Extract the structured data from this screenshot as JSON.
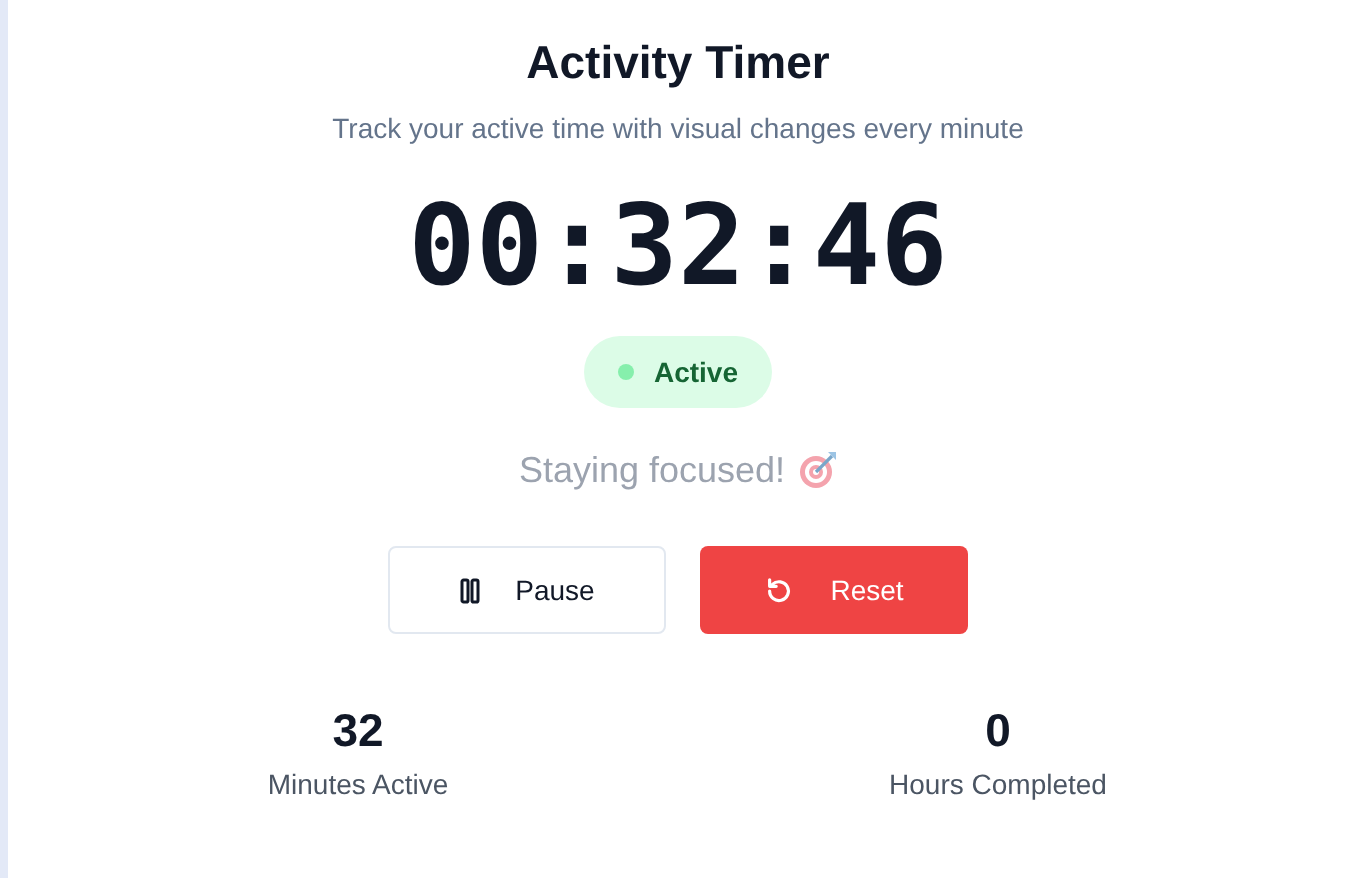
{
  "title": "Activity Timer",
  "subtitle": "Track your active time with visual changes every minute",
  "timer": "00:32:46",
  "status": {
    "label": "Active",
    "active": true
  },
  "message": "Staying focused!",
  "buttons": [
    {
      "kind": "pause",
      "label": "Pause"
    },
    {
      "kind": "reset",
      "label": "Reset"
    }
  ],
  "stats": [
    {
      "value": "32",
      "label": "Minutes Active"
    },
    {
      "value": "0",
      "label": "Hours Completed"
    }
  ]
}
